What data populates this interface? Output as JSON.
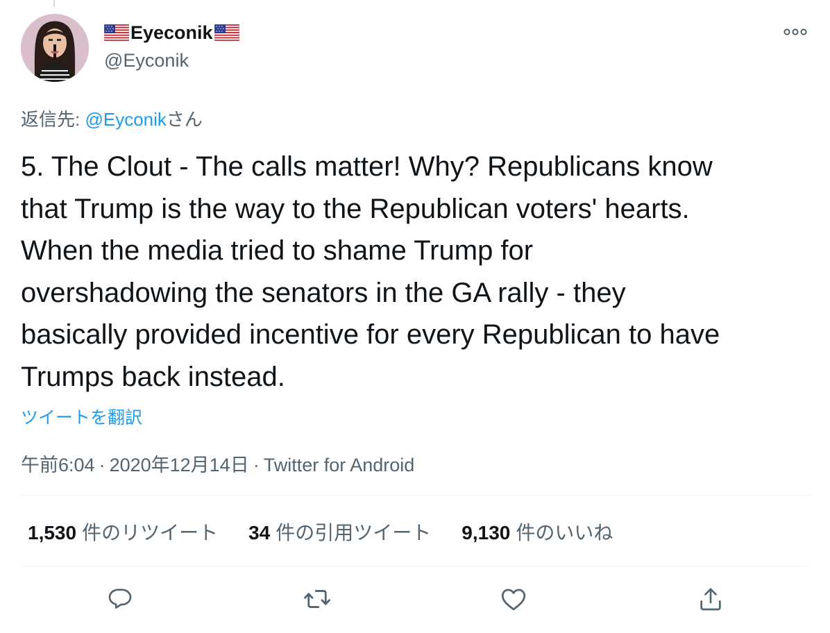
{
  "tweet": {
    "author": {
      "display_name": "Eyeconik",
      "handle": "@Eyconik",
      "flag_icon": "us-flag-icon"
    },
    "reply_to": {
      "prefix": "返信先: ",
      "mention": "@Eyconik",
      "suffix": "さん"
    },
    "text_lines": [
      "5. The Clout - The calls matter! Why? Republicans know",
      "that Trump is the way to the Republican voters' hearts.",
      "When the media tried to shame Trump for",
      "overshadowing the senators in the GA rally - they",
      "basically provided incentive for every Republican to have",
      "Trumps back instead."
    ],
    "translate_label": "ツイートを翻訳",
    "time": "午前6:04",
    "date": "2020年12月14日",
    "separator": "·",
    "source": "Twitter for Android"
  },
  "stats": {
    "retweets": {
      "count": "1,530",
      "label": "件のリツイート"
    },
    "quotes": {
      "count": "34",
      "label": "件の引用ツイート"
    },
    "likes": {
      "count": "9,130",
      "label": "件のいいね"
    }
  },
  "icons": {
    "more": "more-dots-icon",
    "reply": "reply-icon",
    "retweet": "retweet-icon",
    "like": "heart-icon",
    "share": "share-icon"
  },
  "colors": {
    "accent": "#1d9bf0",
    "text": "#0f1419",
    "secondary_text": "#536471",
    "divider": "#eff3f4"
  }
}
